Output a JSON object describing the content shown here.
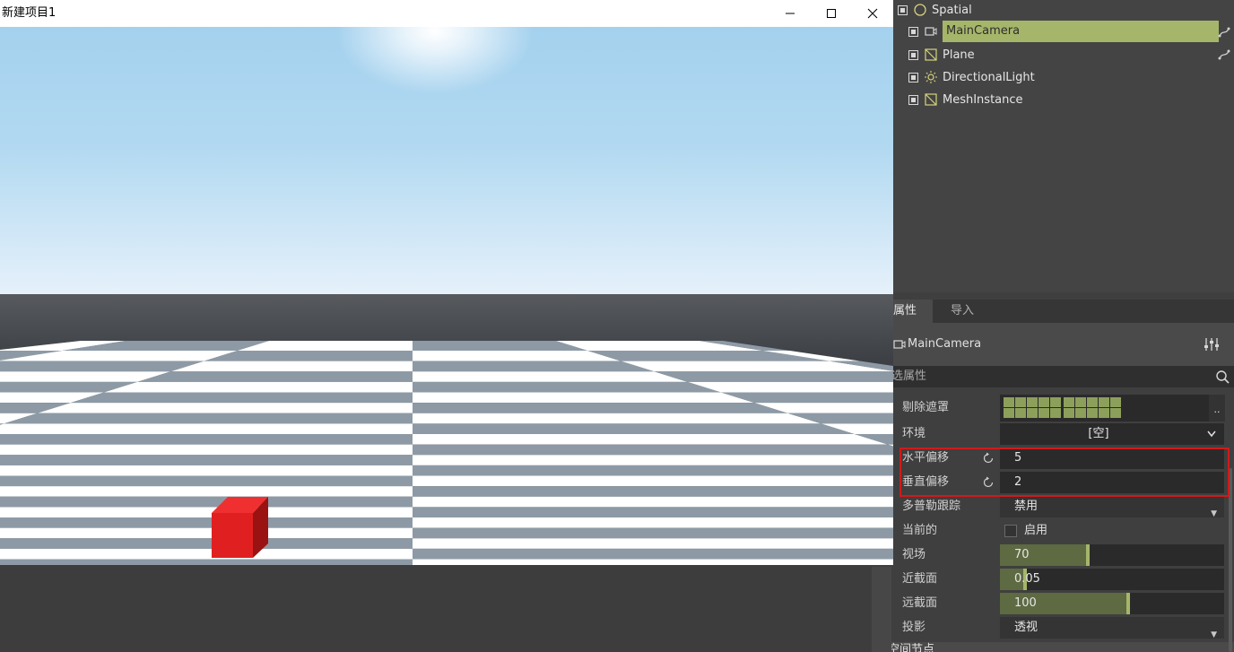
{
  "window": {
    "title": "新建项目1"
  },
  "scene_tree": {
    "root": "Spatial",
    "children": [
      "MainCamera",
      "Plane",
      "DirectionalLight",
      "MeshInstance"
    ],
    "selected": "MainCamera"
  },
  "inspector": {
    "tabs": [
      "属性",
      "导入"
    ],
    "node_name": "MainCamera",
    "filter_placeholder": "选属性",
    "properties": {
      "cull_mask": {
        "label": "剔除遮罩",
        "button": ".."
      },
      "environment": {
        "label": "环境",
        "value": "[空]"
      },
      "h_offset": {
        "label": "水平偏移",
        "value": "5"
      },
      "v_offset": {
        "label": "垂直偏移",
        "value": "2"
      },
      "doppler": {
        "label": "多普勒跟踪",
        "value": "禁用"
      },
      "current": {
        "label": "当前的",
        "checkbox_label": "启用",
        "checked": false
      },
      "fov": {
        "label": "视场",
        "value": "70",
        "fraction": 0.39
      },
      "near": {
        "label": "近截面",
        "value": "0.05",
        "fraction": 0.11
      },
      "far": {
        "label": "远截面",
        "value": "100",
        "fraction": 0.57
      },
      "projection": {
        "label": "投影",
        "value": "透视"
      }
    },
    "next_section_partial": "空间节点"
  },
  "colors": {
    "accent": "#a5b66a",
    "slider_fill": "#5e6a42",
    "highlight": "#d11a1a",
    "cube": "#e02020",
    "checker_light": "#ffffff",
    "checker_dark": "#8d9aa6"
  }
}
